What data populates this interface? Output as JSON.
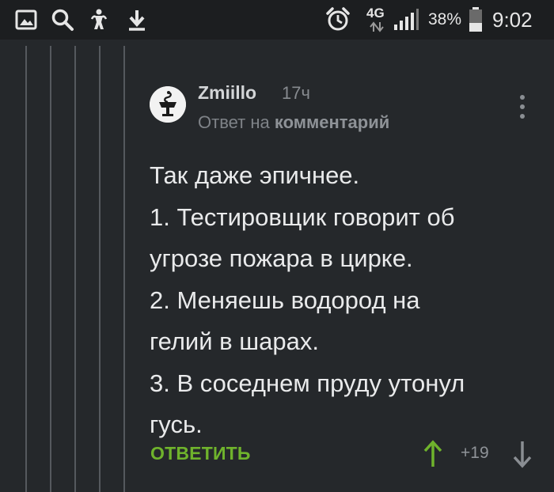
{
  "status_bar": {
    "network": "4G",
    "battery_percent": "38%",
    "time": "9:02",
    "icons": [
      "gallery-icon",
      "search-icon",
      "accessibility-icon",
      "download-icon",
      "alarm-icon",
      "signal-icon",
      "battery-icon"
    ]
  },
  "comment": {
    "avatar_icon": "caduceus-icon",
    "username": "Zmiillo",
    "time": "17ч",
    "reply_prefix": "Ответ на",
    "reply_target": "комментарий",
    "body_lines": [
      "Так даже эпичнее.",
      "1. Тестировщик говорит об",
      "угрозе пожара в цирке.",
      "2. Меняешь водород на",
      "гелий в шарах.",
      "3. В соседнем пруду утонул",
      "гусь."
    ],
    "reply_label": "ОТВЕТИТЬ",
    "score": "+19"
  },
  "colors": {
    "background": "#25282b",
    "status_bar": "#1c1e20",
    "accent_green": "#6fb32c",
    "thread_line": "#55595e"
  }
}
